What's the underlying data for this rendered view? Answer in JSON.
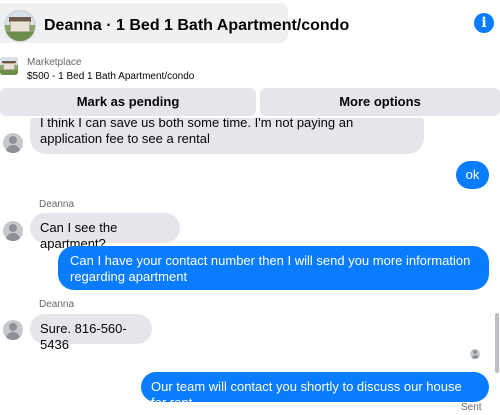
{
  "header": {
    "title": "Deanna · 1 Bed 1 Bath Apartment/condo",
    "info_icon": "info-icon"
  },
  "listing": {
    "label": "Marketplace",
    "price_line": "$500 - 1 Bed 1 Bath Apartment/condo"
  },
  "actions": {
    "mark_pending": "Mark as pending",
    "more_options": "More options"
  },
  "messages": [
    {
      "from": "Deanna",
      "direction": "incoming",
      "text": "I think I can save us both some time. I'm not paying an application fee to see a rental",
      "partial": true
    },
    {
      "direction": "outgoing",
      "text": "ok"
    },
    {
      "from": "Deanna",
      "direction": "incoming",
      "text": "Can I see the apartment?"
    },
    {
      "direction": "outgoing",
      "text": "Can I have your contact number then I will  send you more information regarding apartment"
    },
    {
      "from": "Deanna",
      "direction": "incoming",
      "text": "Sure. 816-560-5436"
    },
    {
      "direction": "outgoing",
      "text": "Our team will contact you shortly to discuss our house for rent."
    }
  ],
  "status": "Sent",
  "colors": {
    "outgoing_bubble": "#0a7cff",
    "incoming_bubble": "#e4e6eb",
    "button_bg": "#e4e6eb"
  }
}
